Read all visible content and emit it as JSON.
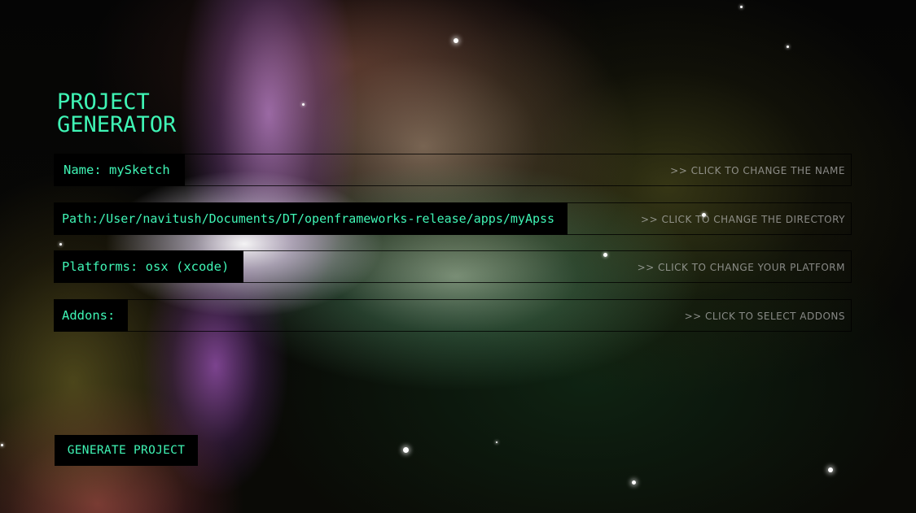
{
  "app": {
    "title_line1": "PROJECT",
    "title_line2": "GENERATOR"
  },
  "fields": {
    "name": {
      "label": "Name: ",
      "value": "mySketch",
      "hint": ">> CLICK TO CHANGE THE NAME"
    },
    "path": {
      "label": "Path:",
      "value": "/User/navitush/Documents/DT/openframeworks-release/apps/myApss",
      "hint": ">> CLICK TO CHANGE THE DIRECTORY"
    },
    "platforms": {
      "label": "Platforms: ",
      "value": "osx (xcode)",
      "hint": ">> CLICK TO CHANGE YOUR PLATFORM"
    },
    "addons": {
      "label": "Addons: ",
      "value": "",
      "hint": ">> CLICK TO SELECT ADDONS"
    }
  },
  "actions": {
    "generate_label": "GENERATE PROJECT"
  },
  "colors": {
    "accent": "#3ff5b5",
    "label_bg": "#000000",
    "hint_text": "#c8c8c8"
  }
}
